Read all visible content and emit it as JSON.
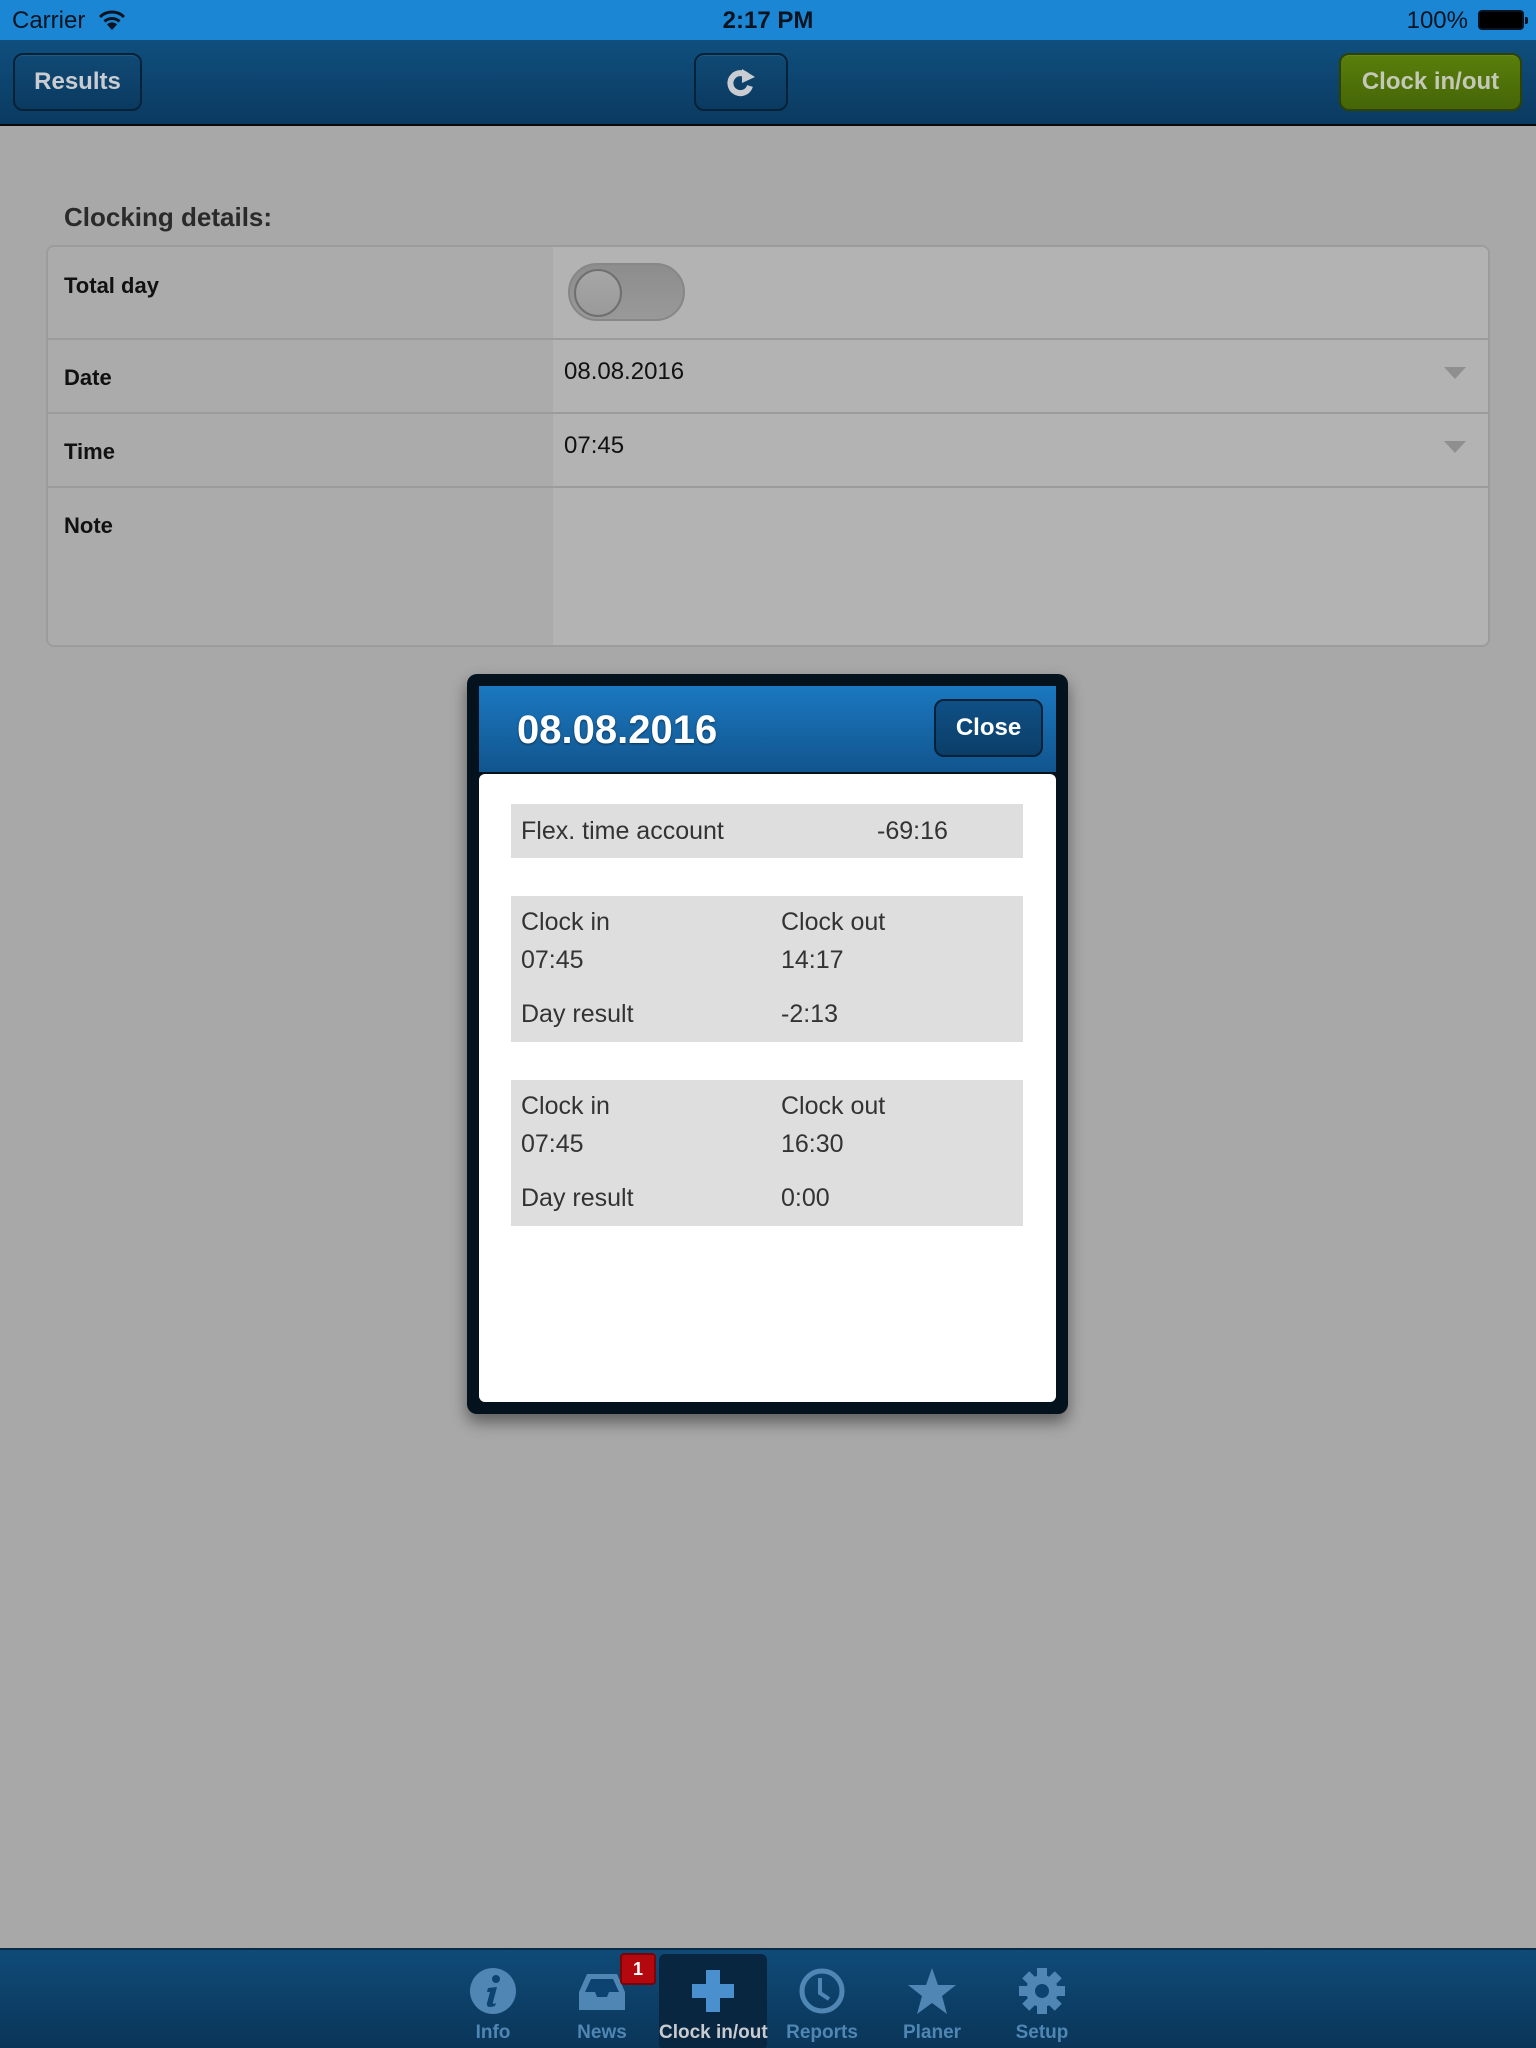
{
  "status_bar": {
    "carrier": "Carrier",
    "time": "2:17 PM",
    "battery_percent": "100%"
  },
  "toolbar": {
    "results_label": "Results",
    "refresh_icon": "refresh-icon",
    "clock_label": "Clock in/out",
    "clock_color": "#5a7f0b",
    "bar_color": "#0f4f7e"
  },
  "form": {
    "title": "Clocking details:",
    "rows": [
      {
        "label": "Total day",
        "type": "toggle",
        "on": false
      },
      {
        "label": "Date",
        "value": "08.08.2016",
        "type": "select"
      },
      {
        "label": "Time",
        "value": "07:45",
        "type": "select"
      },
      {
        "label": "Note",
        "value": "",
        "type": "textarea"
      }
    ]
  },
  "dialog": {
    "title": "08.08.2016",
    "close_label": "Close",
    "flex_label": "Flex. time account",
    "flex_value": "-69:16",
    "entries": [
      {
        "clock_in_label": "Clock in",
        "clock_in": "07:45",
        "clock_out_label": "Clock out",
        "clock_out": "14:17",
        "result_label": "Day result",
        "result": "-2:13"
      },
      {
        "clock_in_label": "Clock in",
        "clock_in": "07:45",
        "clock_out_label": "Clock out",
        "clock_out": "16:30",
        "result_label": "Day result",
        "result": "0:00"
      }
    ]
  },
  "tabbar": {
    "tabs": [
      {
        "label": "Info",
        "icon": "info-icon"
      },
      {
        "label": "News",
        "icon": "inbox-icon",
        "badge": "1"
      },
      {
        "label": "Clock in/out",
        "icon": "plus-icon",
        "active": true
      },
      {
        "label": "Reports",
        "icon": "clock-icon"
      },
      {
        "label": "Planer",
        "icon": "star-icon"
      },
      {
        "label": "Setup",
        "icon": "gear-icon"
      }
    ],
    "accent_color": "#4f86b3",
    "badge_color": "#b3080d"
  }
}
